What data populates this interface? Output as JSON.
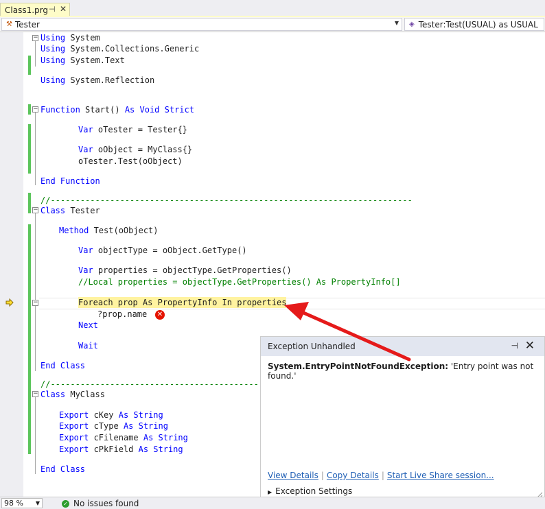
{
  "tab": {
    "title": "Class1.prg",
    "pin": "⊣",
    "close": "✕"
  },
  "nav": {
    "left_combo": "Tester",
    "right_combo": "Tester:Test(USUAL) as USUAL"
  },
  "code": {
    "l1_kw": "Using",
    "l1_rest": " System",
    "l2_kw": "Using",
    "l2_rest": " System.Collections.Generic",
    "l3_kw": "Using",
    "l3_rest": " System.Text",
    "l4_kw": "Using",
    "l4_rest": " System.Reflection",
    "l5_kw1": "Function",
    "l5_mid": " Start() ",
    "l5_kw2": "As Void Strict",
    "l6_kw": "Var",
    "l6_rest": " oTester = Tester{}",
    "l7_kw": "Var",
    "l7_rest": " oObject = MyClass{}",
    "l8": "oTester.Test(oObject)",
    "l9": "End Function",
    "l10": "//-------------------------------------------------------------------------",
    "l11_kw": "Class",
    "l11_rest": " Tester",
    "l12_kw": "Method",
    "l12_rest": " Test(oObject)",
    "l13_kw": "Var",
    "l13_rest": " objectType = oObject.GetType()",
    "l14_kw": "Var",
    "l14_rest": " properties = objectType.GetProperties()",
    "l15": "//Local properties = objectType.GetProperties() As PropertyInfo[]",
    "l16": "Foreach prop As PropertyInfo In properties",
    "l17": "?prop.name",
    "l18": "Next",
    "l19": "Wait",
    "l20": "End Class",
    "l21": "//------------------------------------------",
    "l22_kw": "Class",
    "l22_rest": " MyClass",
    "l23_kw": "Export",
    "l23_mid": " cKey ",
    "l23_kw2": "As String",
    "l24_kw": "Export",
    "l24_mid": " cType ",
    "l24_kw2": "As String",
    "l25_kw": "Export",
    "l25_mid": " cFilename ",
    "l25_kw2": "As String",
    "l26_kw": "Export",
    "l26_mid": " cPkField ",
    "l26_kw2": "As String",
    "l27": "End Class"
  },
  "exception": {
    "header": "Exception Unhandled",
    "type": "System.EntryPointNotFoundException:",
    "message": " 'Entry point was not found.'",
    "links": [
      "View Details",
      "Copy Details",
      "Start Live Share session..."
    ],
    "settings": "Exception Settings"
  },
  "status": {
    "zoom": "98 %",
    "issues": "No issues found"
  },
  "colors": {
    "keyword": "#0000ff",
    "comment": "#008000",
    "highlight": "#fff3a0",
    "annotation_arrow": "#e51a1a"
  }
}
